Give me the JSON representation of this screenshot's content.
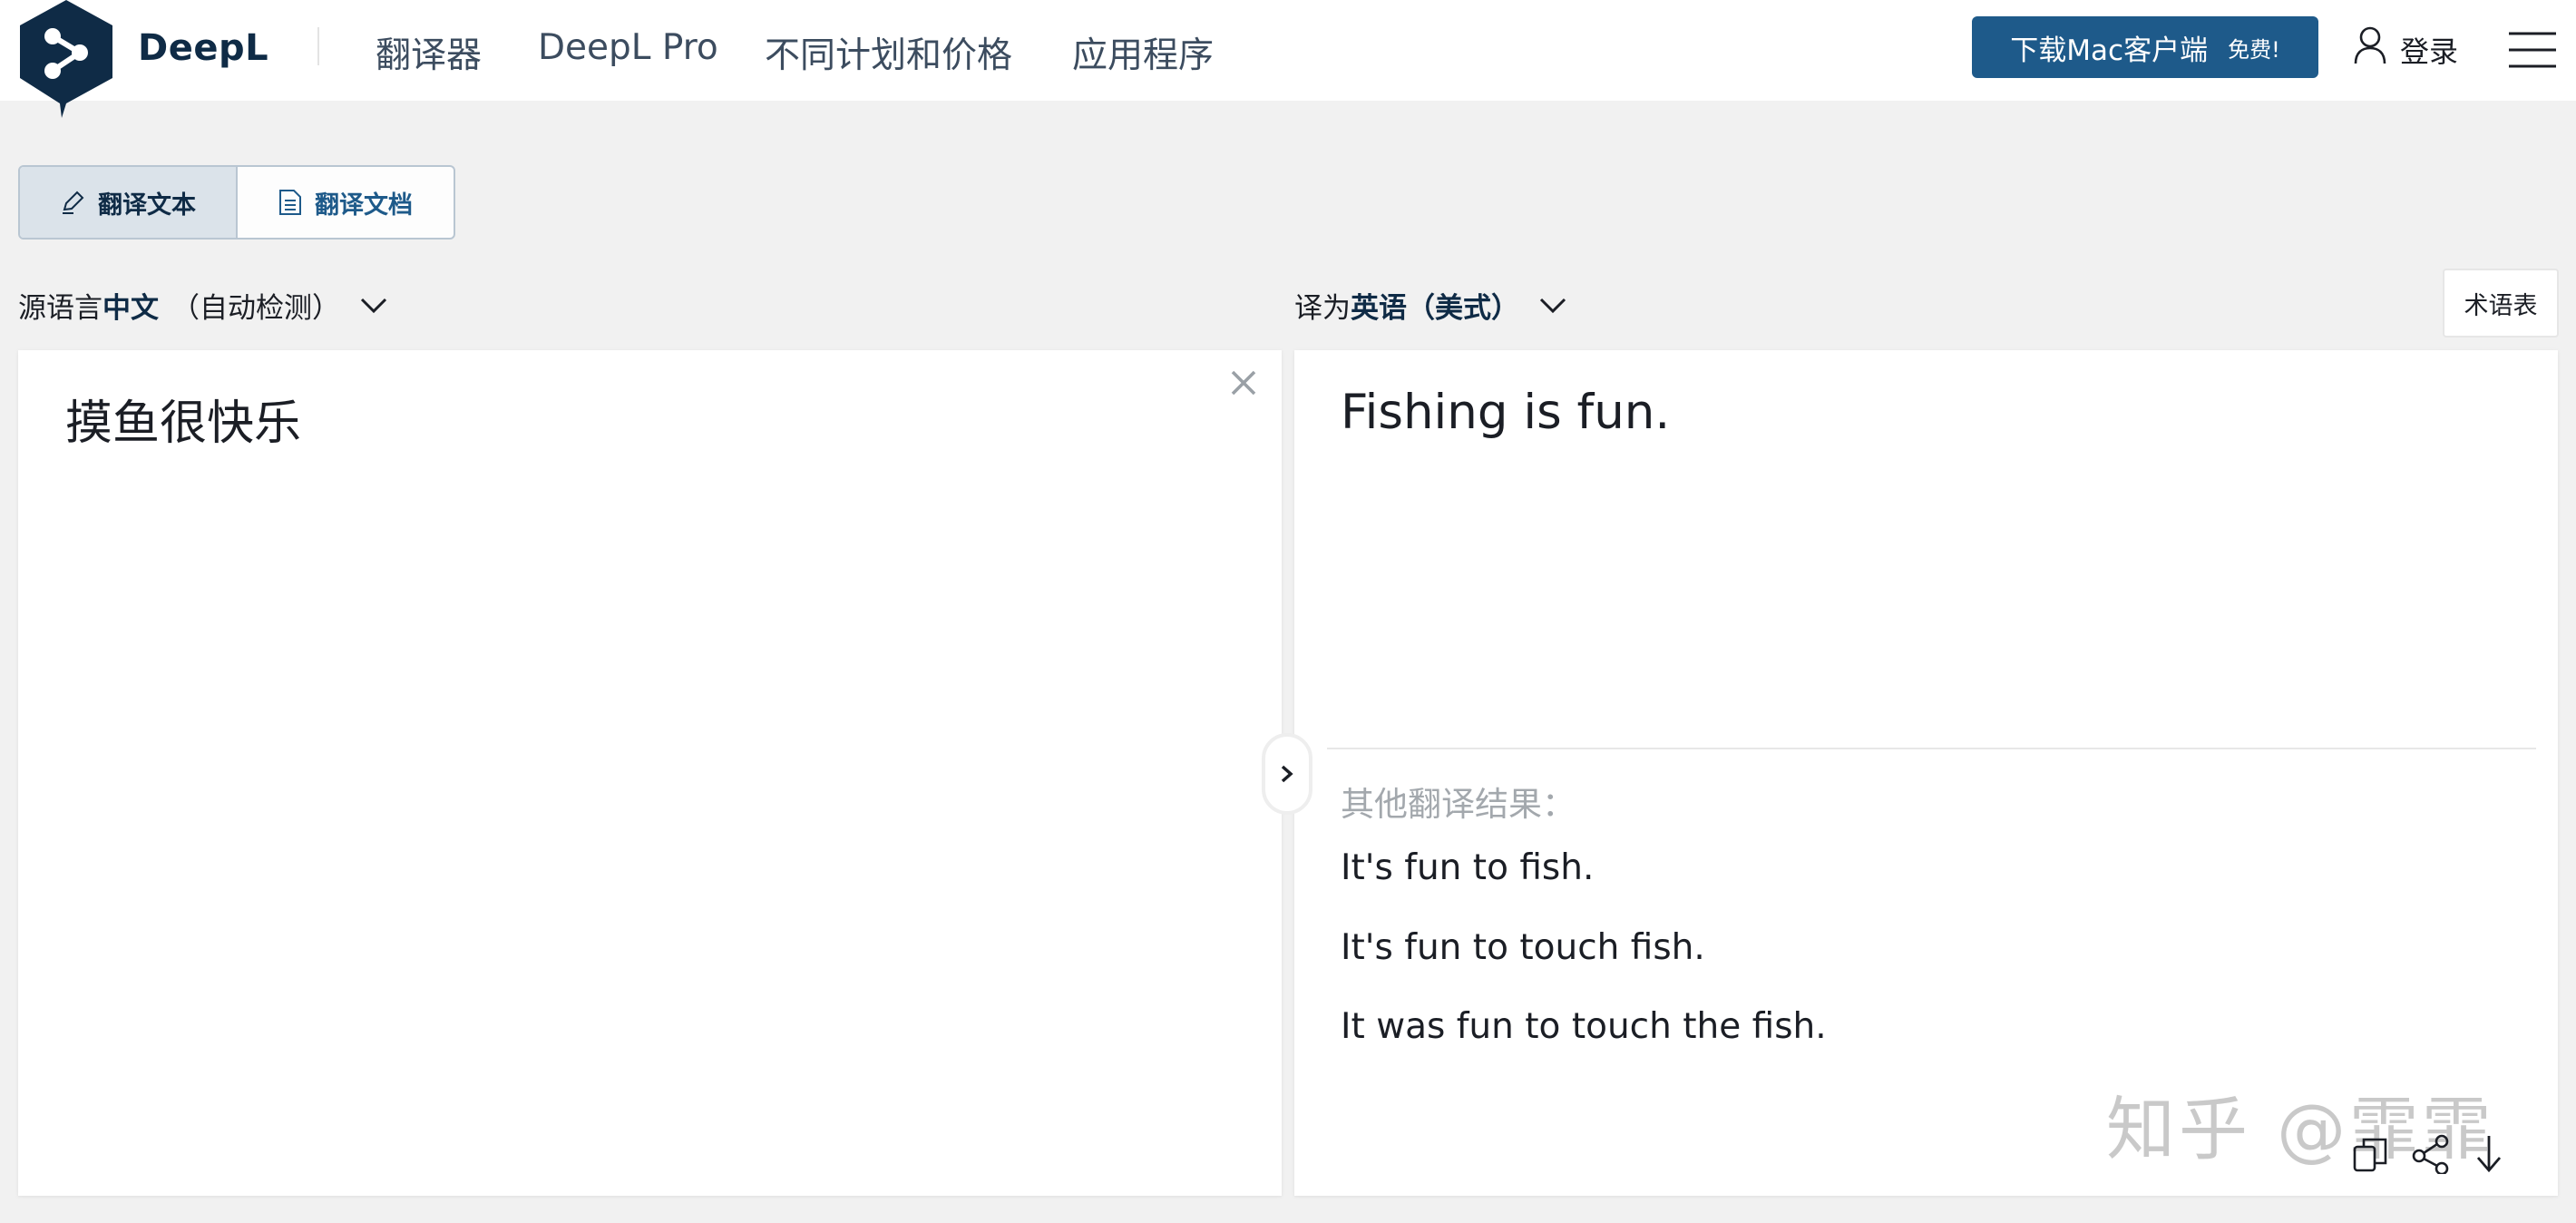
{
  "header": {
    "brand": "DeepL",
    "nav": [
      "翻译器",
      "DeepL Pro",
      "不同计划和价格",
      "应用程序"
    ],
    "download_button": {
      "label": "下载Mac客户端",
      "badge": "免费!"
    },
    "login_label": "登录",
    "icons": {
      "logo": "deepl-logo",
      "user": "user-icon",
      "menu": "hamburger-menu-icon"
    }
  },
  "tabs": [
    {
      "label": "翻译文本",
      "icon": "pen-icon",
      "active": true
    },
    {
      "label": "翻译文档",
      "icon": "document-icon",
      "active": false
    }
  ],
  "source_lang": {
    "prefix": "源语言",
    "language": "中文",
    "note": "（自动检测）"
  },
  "target_lang": {
    "prefix": "译为",
    "language": "英语（美式）"
  },
  "glossary_label": "术语表",
  "source_text": "摸鱼很快乐",
  "translation": {
    "main": "Fishing is fun.",
    "alternatives_heading": "其他翻译结果：",
    "alternatives": [
      "It's fun to fish.",
      "It's fun to touch fish.",
      "It was fun to touch the fish."
    ]
  },
  "watermark": "知乎 @霏霏",
  "colors": {
    "brand_navy": "#0f2b46",
    "button_blue": "#1e5a8a",
    "page_bg": "#f1f1f1",
    "muted_text": "#a3a8ad"
  }
}
